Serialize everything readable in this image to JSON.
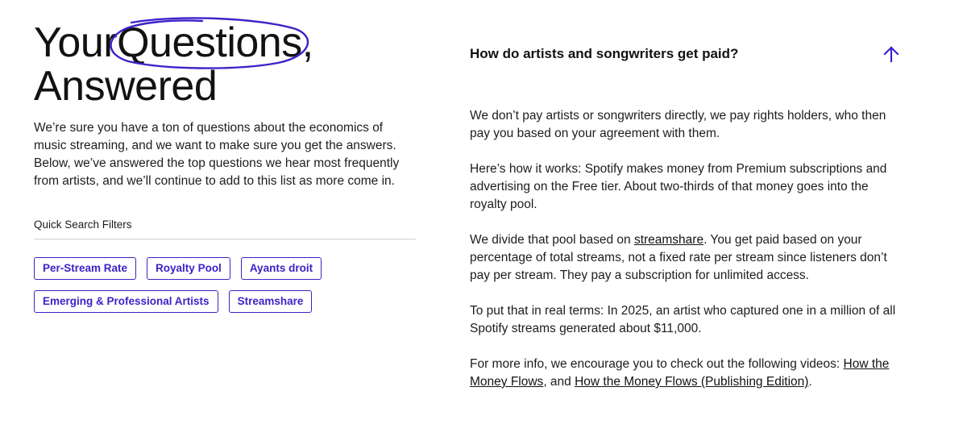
{
  "hero": {
    "title_word1": "Your",
    "title_word2": "Questions,",
    "title_line2": "Answered",
    "intro": "We’re sure you have a ton of questions about the economics of music streaming, and we want to make sure you get the answers. Below, we’ve answered the top questions we hear most frequently from artists, and we’ll continue to add to this list as more come in."
  },
  "filters": {
    "label": "Quick Search Filters",
    "chips": [
      "Per-Stream Rate",
      "Royalty Pool",
      "Ayants droit",
      "Emerging & Professional Artists",
      "Streamshare"
    ]
  },
  "faq": {
    "question": "How do artists and songwriters get paid?",
    "p1": "We don’t pay artists or songwriters directly, we pay rights holders, who then pay you based on your agreement with them.",
    "p2": "Here’s how it works: Spotify makes money from Premium subscriptions and advertising on the Free tier. About two-thirds of that money goes into the royalty pool.",
    "p3_before": "We divide that pool based on ",
    "p3_link": "streamshare",
    "p3_after": ". You get paid based on your percentage of total streams, not a fixed rate per stream since listeners don’t pay per stream. They pay a subscription for unlimited access.",
    "p4": "To put that in real terms: In 2025, an artist who captured one in a million of all Spotify streams generated about $11,000.",
    "p5_before": "For more info, we encourage you to check out the following videos: ",
    "p5_link1": "How the Money Flows",
    "p5_mid": ", and ",
    "p5_link2": "How the Money Flows (Publishing Edition)",
    "p5_after": "."
  },
  "icons": {
    "toggle": "arrow-up-icon",
    "highlight": "hand-drawn-circle"
  },
  "colors": {
    "accent": "#3d22c8",
    "text": "#121212",
    "divider": "#cfcfcf"
  }
}
